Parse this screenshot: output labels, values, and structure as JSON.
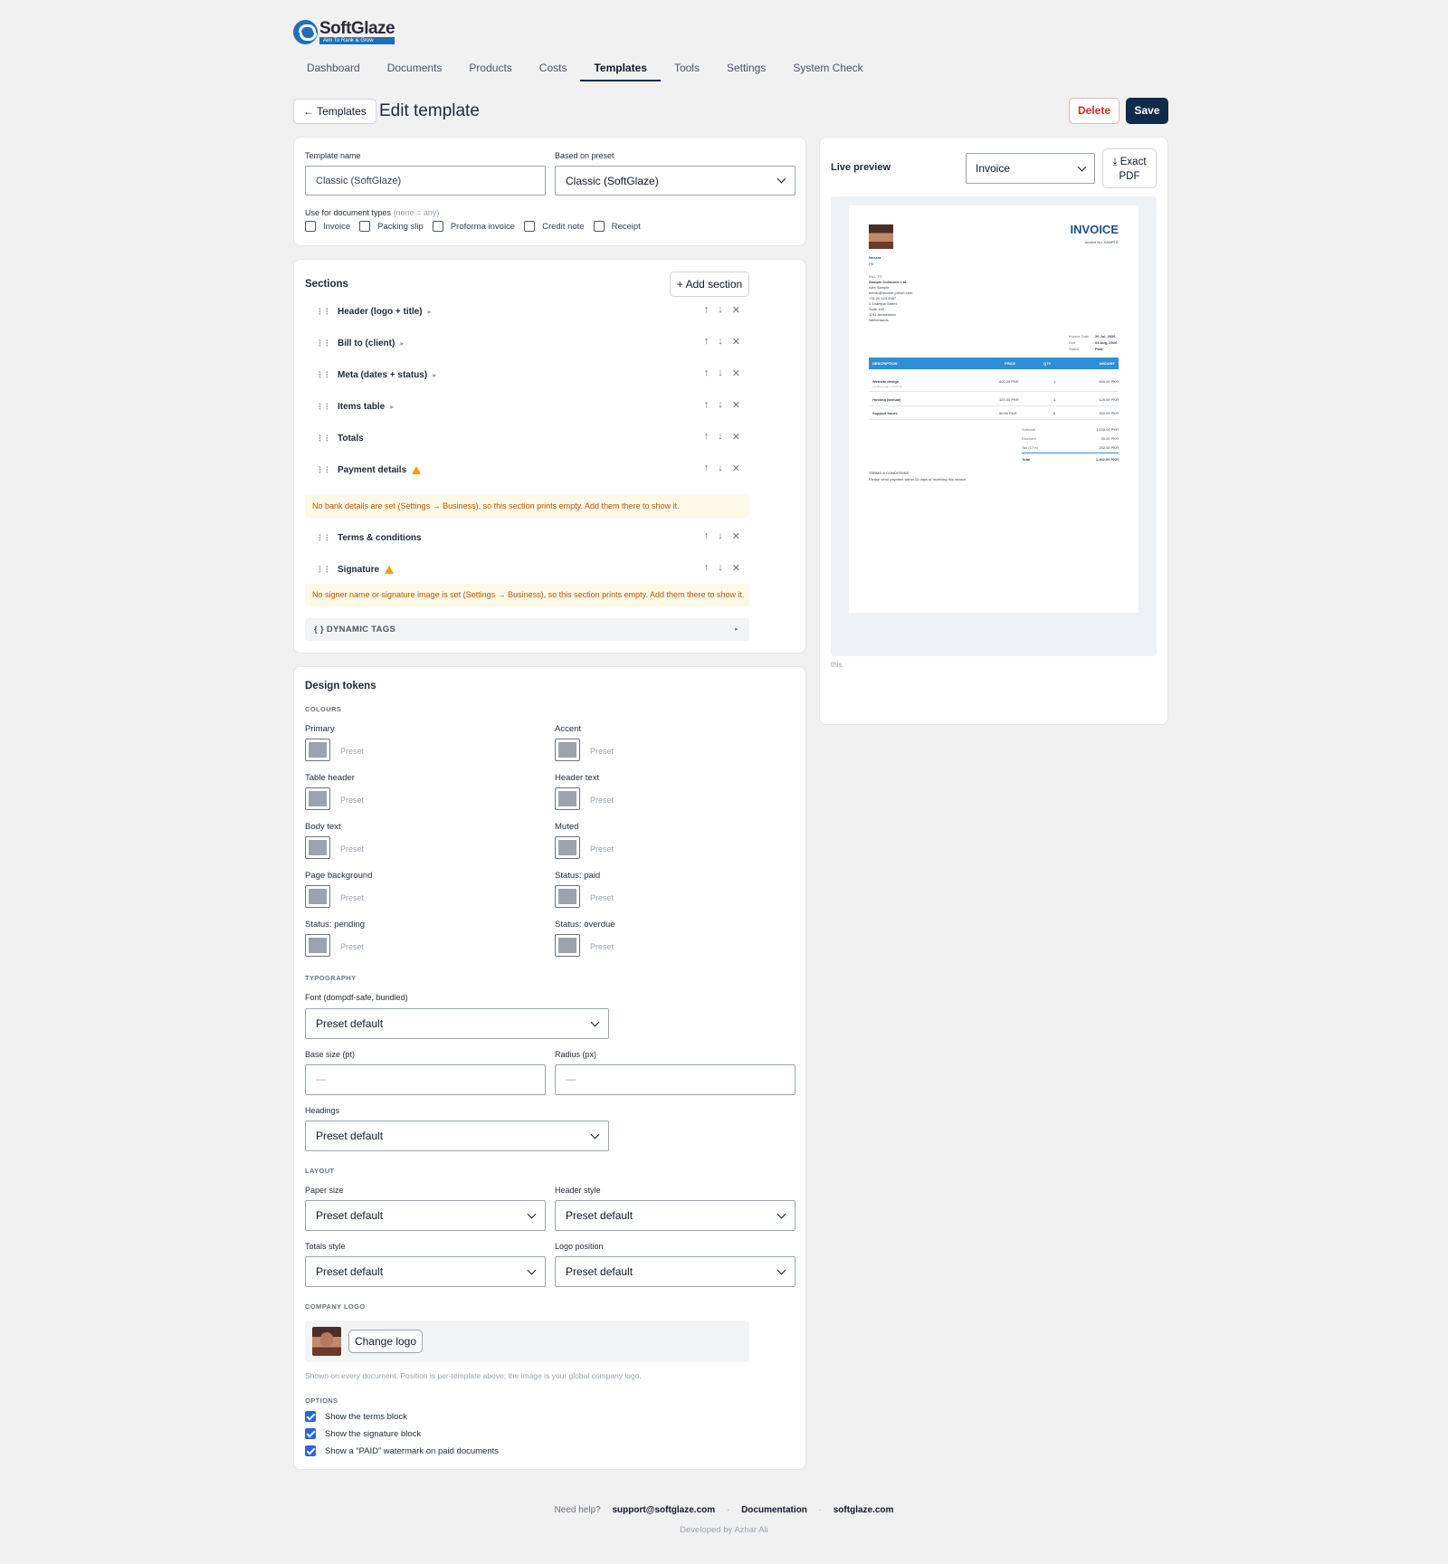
{
  "brand": {
    "name": "SoftGlaze",
    "tagline": "Aim To Rank & Grow"
  },
  "nav": [
    "Dashboard",
    "Documents",
    "Products",
    "Costs",
    "Templates",
    "Tools",
    "Settings",
    "System Check"
  ],
  "header": {
    "back_label": "← Templates",
    "title": "Edit template",
    "delete_label": "Delete",
    "save_label": "Save"
  },
  "basics": {
    "template_name_label": "Template name",
    "template_name_value": "Classic (SoftGlaze)",
    "preset_label": "Based on preset",
    "preset_value": "Classic (SoftGlaze)",
    "doc_types_label": "Use for document types",
    "doc_types_hint": "(none = any)",
    "doc_types": [
      "Invoice",
      "Packing slip",
      "Proforma invoice",
      "Credit note",
      "Receipt"
    ]
  },
  "sections": {
    "title": "Sections",
    "add_label": "+ Add section",
    "items": [
      {
        "label": "Header (logo + title)"
      },
      {
        "label": "Bill to (client)"
      },
      {
        "label": "Meta (dates + status)"
      },
      {
        "label": "Items table"
      },
      {
        "label": "Totals"
      },
      {
        "label": "Payment details"
      },
      {
        "label": "Terms & conditions"
      },
      {
        "label": "Signature"
      }
    ],
    "warning_payment": "No bank details are set (Settings → Business), so this section prints empty. Add them there to show it.",
    "warning_signature": "No signer name or signature image is set (Settings → Business), so this section prints empty. Add them there to show it.",
    "dynamic_tags": "{ } DYNAMIC TAGS",
    "expand_glyph": "▸",
    "actions": {
      "up": "↑",
      "down": "↓",
      "remove": "✕"
    }
  },
  "design": {
    "title": "Design tokens",
    "colours_heading": "COLOURS",
    "preset_text": "Preset",
    "colours": [
      "Primary",
      "Accent",
      "Table header",
      "Header text",
      "Body text",
      "Muted",
      "Page background",
      "Status: paid",
      "Status: pending",
      "Status: overdue"
    ],
    "typography_heading": "TYPOGRAPHY",
    "font_label": "Font (dompdf-safe, bundled)",
    "font_value": "Preset default",
    "base_size_label": "Base size (pt)",
    "base_size_placeholder": "—",
    "radius_label": "Radius (px)",
    "radius_placeholder": "—",
    "headings_label": "Headings",
    "headings_value": "Preset default",
    "layout_heading": "LAYOUT",
    "paper_size_label": "Paper size",
    "paper_size_value": "Preset default",
    "header_style_label": "Header style",
    "header_style_value": "Preset default",
    "totals_style_label": "Totals style",
    "totals_style_value": "Preset default",
    "logo_position_label": "Logo position",
    "logo_position_value": "Preset default",
    "company_logo_heading": "COMPANY LOGO",
    "change_logo_label": "Change logo",
    "logo_help": "Shown on every document. Position is per-template above; the image is your global company logo.",
    "options_heading": "OPTIONS",
    "options": [
      "Show the terms block",
      "Show the signature block",
      "Show a “PAID” watermark on paid documents"
    ]
  },
  "preview": {
    "title": "Live preview",
    "doc_type": "Invoice",
    "pdf_label_1": "⤓ Exact",
    "pdf_label_2": "PDF",
    "note": "this.",
    "invoice": {
      "heading": "INVOICE",
      "number": "Invoice No. SAMPLE",
      "company": "Nexara",
      "company_sub": "PK",
      "bill_to": "BILL TO",
      "client": "Sample Customer Ltd.",
      "client_lines": [
        "Alex Sample",
        "admin@invoice.preset.com",
        "+31 20 123 4567",
        "1 Example Street",
        "Suite 100",
        "1011 Amsterdam",
        "Netherlands"
      ],
      "meta_labels": [
        "Invoice Date",
        "Due",
        "Status"
      ],
      "meta_values": [
        "20 Jul, 2026",
        "04 Aug, 2026",
        "Paid"
      ],
      "columns": [
        "DESCRIPTION",
        "PRICE",
        "QTY",
        "AMOUNT"
      ],
      "rows": [
        {
          "desc": "Website design",
          "sub": "Landing page + brand kit",
          "price": "800.00 PKR",
          "qty": "1",
          "amount": "800.00 PKR"
        },
        {
          "desc": "Hosting (annual)",
          "sub": "",
          "price": "120.00 PKR",
          "qty": "1",
          "amount": "120.00 PKR"
        },
        {
          "desc": "Support hours",
          "sub": "",
          "price": "50.00 PKR",
          "qty": "6",
          "amount": "300.00 PKR"
        }
      ],
      "totals_labels": [
        "Subtotal",
        "Discount",
        "Tax (17%)",
        "Total"
      ],
      "totals_values": [
        "1,220.00 PKR",
        "20.00 PKR",
        "202.00 PKR",
        "1,402.00 PKR"
      ],
      "terms_heading": "TERMS & CONDITIONS",
      "terms_text": "Please send payment within 15 days of receiving this invoice."
    }
  },
  "footer": {
    "help": "Need help?",
    "email": "support@softglaze.com",
    "docs": "Documentation",
    "site": "softglaze.com",
    "dev": "Developed by Azhar Ali",
    "separator": "·"
  }
}
